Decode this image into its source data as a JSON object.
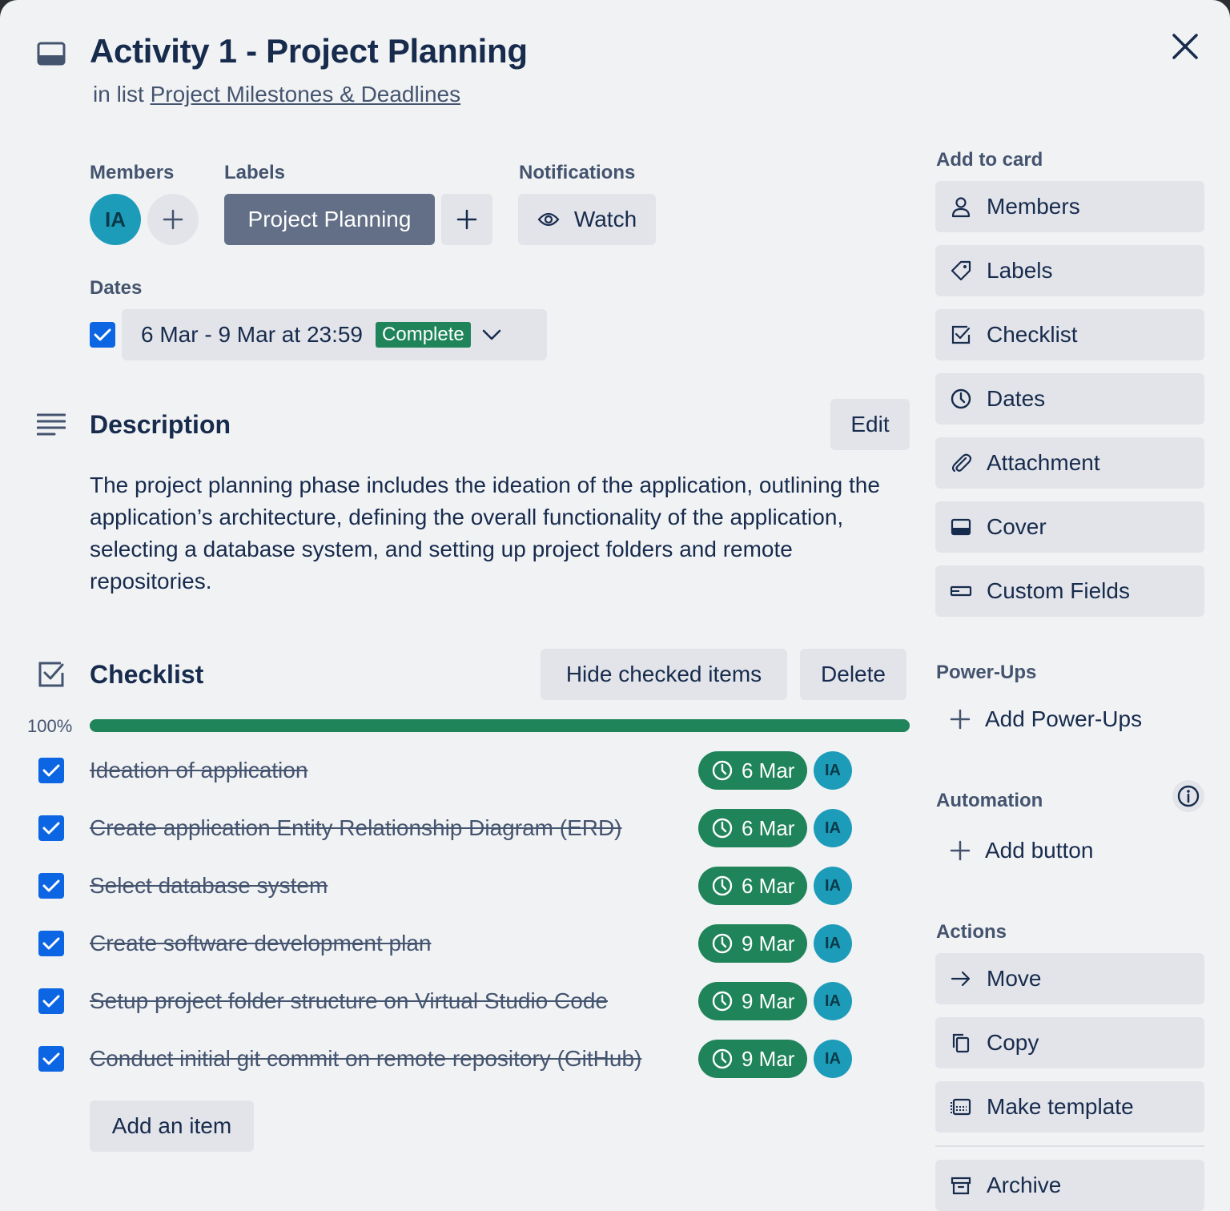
{
  "card": {
    "title": "Activity 1 - Project Planning",
    "in_list_prefix": "in list",
    "list_name": "Project Milestones & Deadlines"
  },
  "members": {
    "heading": "Members",
    "avatar_initials": "IA"
  },
  "labels": {
    "heading": "Labels",
    "items": [
      "Project Planning"
    ]
  },
  "notifications": {
    "heading": "Notifications",
    "watch_label": "Watch"
  },
  "dates": {
    "heading": "Dates",
    "range": "6 Mar - 9 Mar at 23:59",
    "status": "Complete",
    "checked": true
  },
  "description": {
    "heading": "Description",
    "edit_label": "Edit",
    "text": "The project planning phase includes the ideation of the application, outlining the application’s architecture, defining the overall functionality of the application, selecting a database system, and setting up project folders and remote repositories."
  },
  "checklist": {
    "heading": "Checklist",
    "hide_label": "Hide checked items",
    "delete_label": "Delete",
    "progress_text": "100%",
    "progress_value": 1.0,
    "add_item_label": "Add an item",
    "items": [
      {
        "text": "Ideation of application",
        "due": "6 Mar",
        "assignee": "IA",
        "checked": true
      },
      {
        "text": "Create application Entity Relationship Diagram (ERD)",
        "due": "6 Mar",
        "assignee": "IA",
        "checked": true
      },
      {
        "text": "Select database system",
        "due": "6 Mar",
        "assignee": "IA",
        "checked": true
      },
      {
        "text": "Create software development plan",
        "due": "9 Mar",
        "assignee": "IA",
        "checked": true
      },
      {
        "text": "Setup project folder structure on Virtual Studio Code",
        "due": "9 Mar",
        "assignee": "IA",
        "checked": true
      },
      {
        "text": "Conduct initial git commit on remote repository (GitHub)",
        "due": "9 Mar",
        "assignee": "IA",
        "checked": true
      }
    ]
  },
  "sidebar": {
    "add_to_card_heading": "Add to card",
    "add_to_card": [
      {
        "label": "Members",
        "icon": "person-icon"
      },
      {
        "label": "Labels",
        "icon": "tag-icon"
      },
      {
        "label": "Checklist",
        "icon": "checklist-icon"
      },
      {
        "label": "Dates",
        "icon": "clock-icon"
      },
      {
        "label": "Attachment",
        "icon": "paperclip-icon"
      },
      {
        "label": "Cover",
        "icon": "cover-icon"
      },
      {
        "label": "Custom Fields",
        "icon": "custom-fields-icon"
      }
    ],
    "powerups_heading": "Power-Ups",
    "add_powerups_label": "Add Power-Ups",
    "automation_heading": "Automation",
    "add_button_label": "Add button",
    "actions_heading": "Actions",
    "actions": [
      {
        "label": "Move",
        "icon": "arrow-right-icon"
      },
      {
        "label": "Copy",
        "icon": "copy-icon"
      },
      {
        "label": "Make template",
        "icon": "template-icon"
      },
      {
        "label": "Archive",
        "icon": "archive-icon"
      }
    ]
  },
  "colors": {
    "accent_blue": "#0c66e4",
    "success_green": "#1f845a",
    "avatar_teal": "#1d9cba",
    "label_gray": "#626f86",
    "panel_bg": "#f1f2f4",
    "button_bg": "#e2e4e9"
  }
}
